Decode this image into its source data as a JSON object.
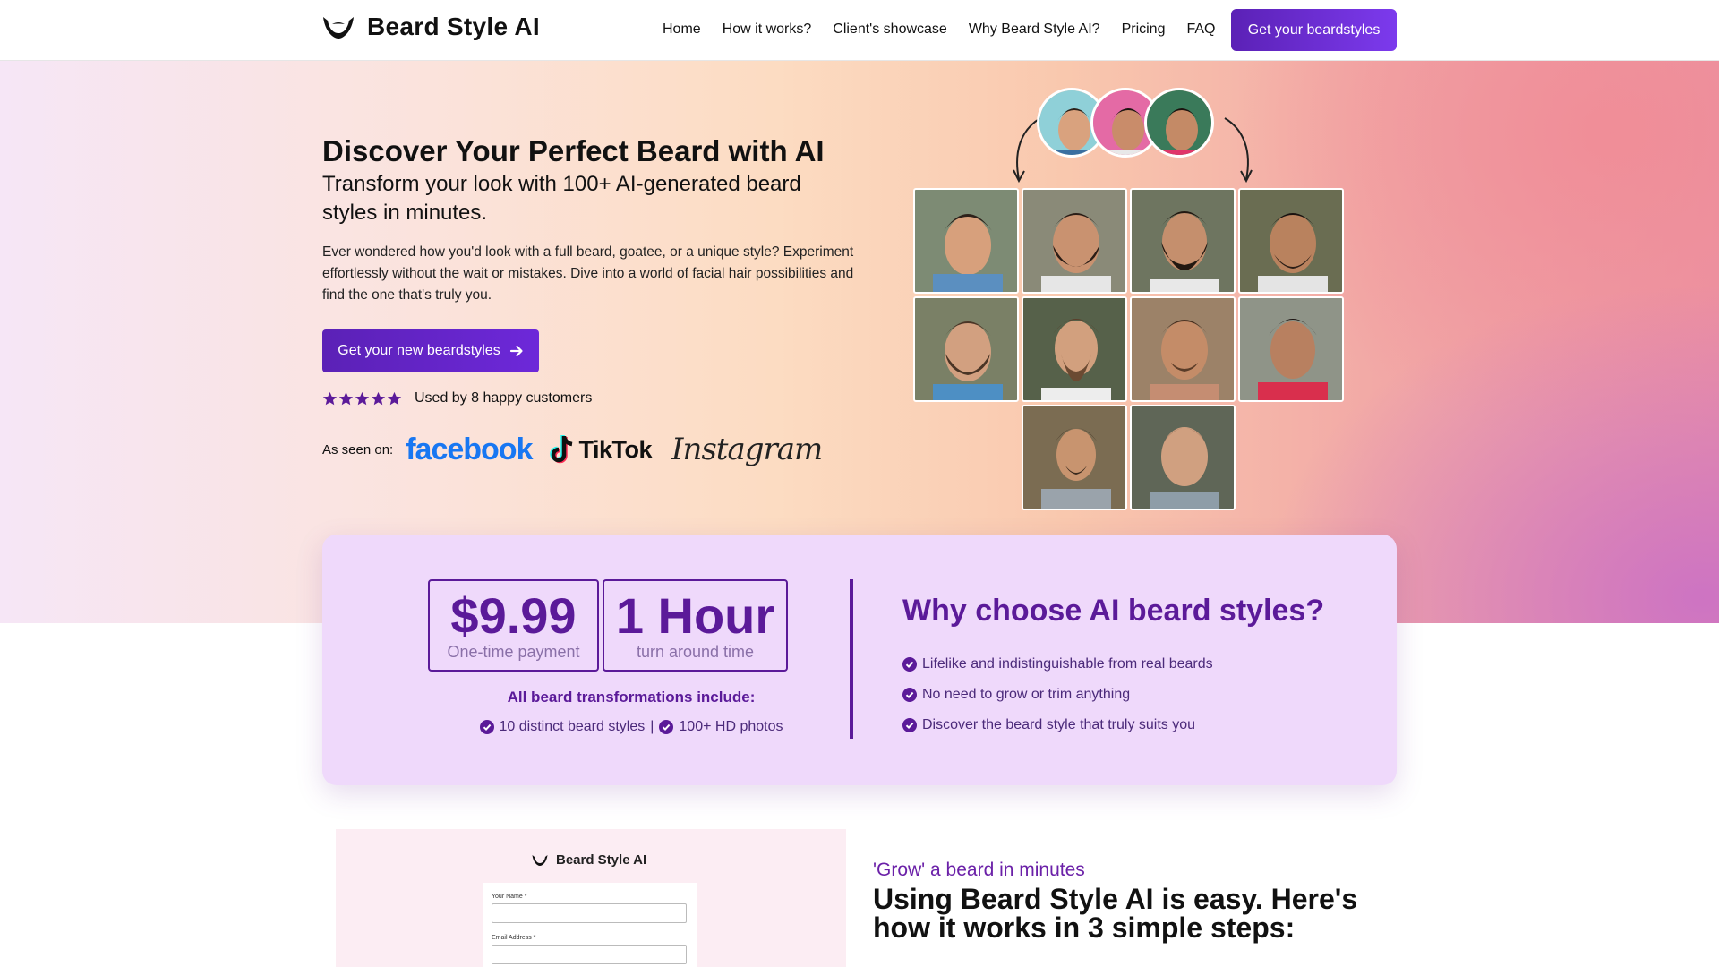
{
  "brand": {
    "name": "Beard Style AI",
    "logo_icon": "beard-logo-icon"
  },
  "nav": {
    "items": [
      {
        "label": "Home"
      },
      {
        "label": "How it works?"
      },
      {
        "label": "Client's showcase"
      },
      {
        "label": "Why Beard Style AI?"
      },
      {
        "label": "Pricing"
      },
      {
        "label": "FAQ"
      }
    ],
    "cta": "Get your beardstyles"
  },
  "hero": {
    "title": "Discover Your Perfect Beard with AI",
    "subtitle": "Transform your look with 100+ AI-generated beard styles in minutes.",
    "description": "Ever wondered how you'd look with a full beard, goatee, or a unique style? Experiment effortlessly without the wait or mistakes. Dive into a world of facial hair possibilities and find the one that's truly you.",
    "cta": "Get your new beardstyles",
    "rating": {
      "stars": 5,
      "text": "Used by 8 happy customers"
    },
    "seen_on": {
      "label": "As seen on:",
      "logos": [
        "facebook",
        "TikTok",
        "Instagram"
      ]
    }
  },
  "colors": {
    "accent": "#5b1a99",
    "cta": "#6d28d9",
    "card_bg": "#efd9fb"
  },
  "pricing": {
    "price": {
      "value": "$9.99",
      "caption": "One-time payment"
    },
    "turnaround": {
      "value": "1 Hour",
      "caption": "turn around time"
    },
    "includes_title": "All beard transformations include:",
    "includes": [
      "10 distinct beard styles",
      "100+ HD photos"
    ],
    "separator": "|",
    "why_title": "Why choose AI beard styles?",
    "why_items": [
      "Lifelike and indistinguishable from real beards",
      "No need to grow or trim anything",
      "Discover the beard style that truly suits you"
    ]
  },
  "preview": {
    "brand": "Beard Style AI",
    "fields": [
      {
        "label": "Your Name *"
      },
      {
        "label": "Email Address *"
      }
    ]
  },
  "steps": {
    "kicker": "'Grow' a beard in minutes",
    "title": "Using Beard Style AI is easy. Here's how it works in 3 simple steps:"
  }
}
